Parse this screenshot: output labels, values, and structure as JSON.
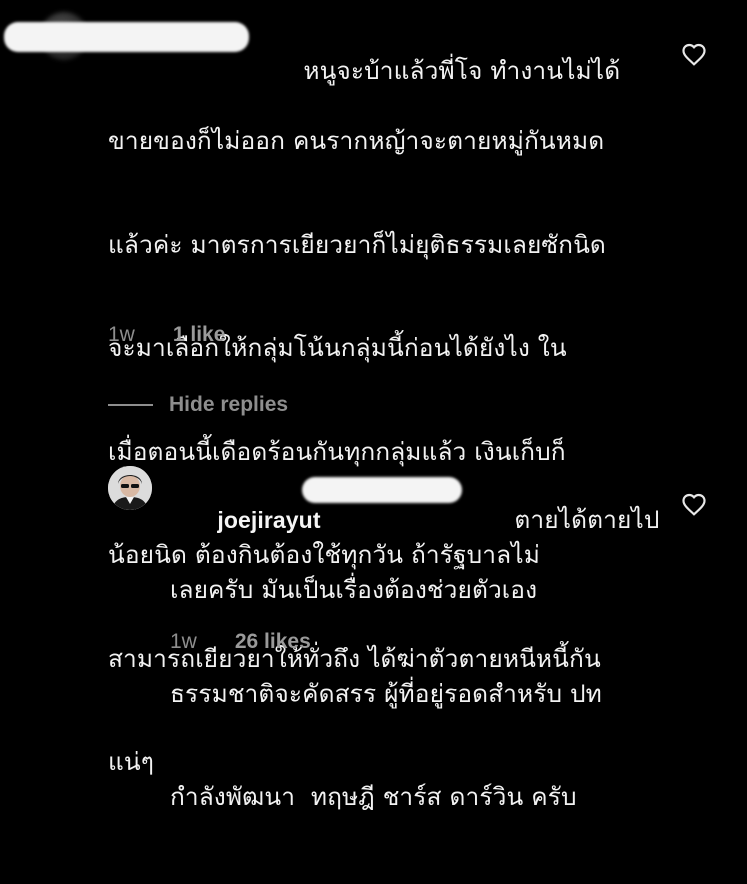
{
  "comment": {
    "text_first": "หนูจะบ้าแล้วพี่โจ ทำงานไม่ได้",
    "text_lines": [
      "ขายของก็ไม่ออก คนรากหญ้าจะตายหมู่กันหมด",
      "แล้วค่ะ มาตรการเยียวยาก็ไม่ยุติธรรมเลยซักนิด",
      "จะมาเลือกให้กลุ่มโน้นกลุ่มนี้ก่อนได้ยังไง ใน",
      "เมื่อตอนนี้เดือดร้อนกันทุกกลุ่มแล้ว เงินเก็บก็",
      "น้อยนิด ต้องกินต้องใช้ทุกวัน ถ้ารัฐบาลไม่",
      "สามารถเยียวยาให้ทั่วถึง ได้ฆ่าตัวตายหนีหนี้กัน",
      "แน่ๆ"
    ],
    "time": "1w",
    "likes": "1 like",
    "heart_icon": "heart-outline-icon"
  },
  "replies_toggle": {
    "label": "Hide replies"
  },
  "reply": {
    "username": "joejirayut",
    "text_first": "ตายได้ตายไป",
    "text_lines": [
      "เลยครับ มันเป็นเรื่องต้องช่วยตัวเอง",
      "ธรรมชาติจะคัดสรร ผู้ที่อยู่รอดสำหรับ ปท",
      "กำลังพัฒนา  ทฤษฎี ชาร์ส ดาร์วิน ครับ"
    ],
    "time": "1w",
    "likes": "26 likes",
    "heart_icon": "heart-outline-icon"
  },
  "colors": {
    "background": "#000000",
    "text": "#f2f2f2",
    "muted": "#8e8e8e",
    "redaction": "#f4f4f4"
  }
}
